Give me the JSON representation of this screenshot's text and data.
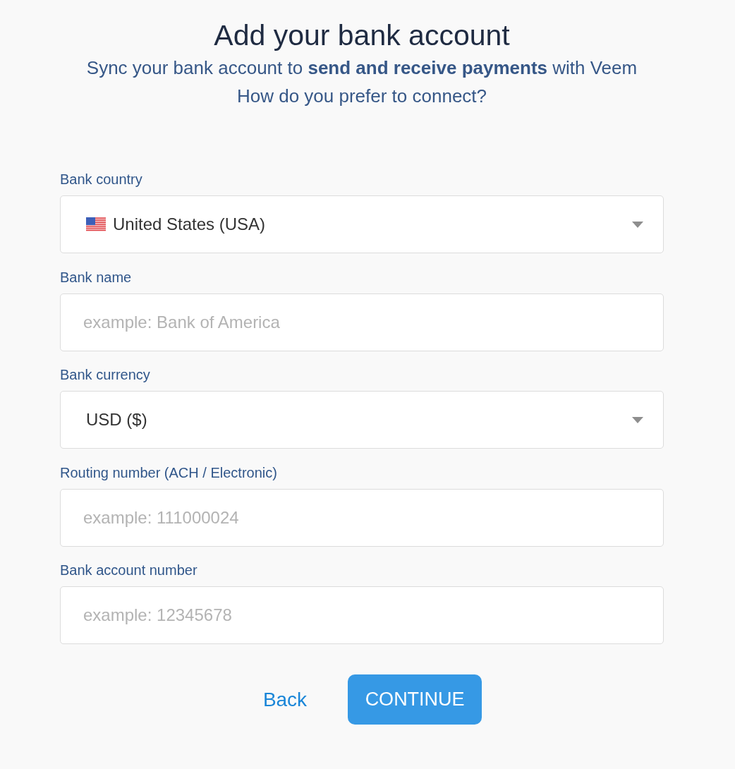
{
  "header": {
    "title": "Add your bank account",
    "subtitle": "Sync your bank account to **send and receive payments** with Veem",
    "question": "How do you prefer to connect?"
  },
  "fields": [
    {
      "kind": "country_select",
      "label": "Bank country",
      "value": "United States (USA)"
    },
    {
      "kind": "text",
      "label": "Bank name",
      "placeholder": "example: Bank of America"
    },
    {
      "kind": "select",
      "label": "Bank currency",
      "value": "USD ($)"
    },
    {
      "kind": "text",
      "label": "Routing number (ACH / Electronic)",
      "placeholder": "example: 111000024"
    },
    {
      "kind": "text",
      "label": "Bank account number",
      "placeholder": "example: 12345678"
    }
  ],
  "actions": {
    "back": "Back",
    "continue": "CONTINUE"
  }
}
